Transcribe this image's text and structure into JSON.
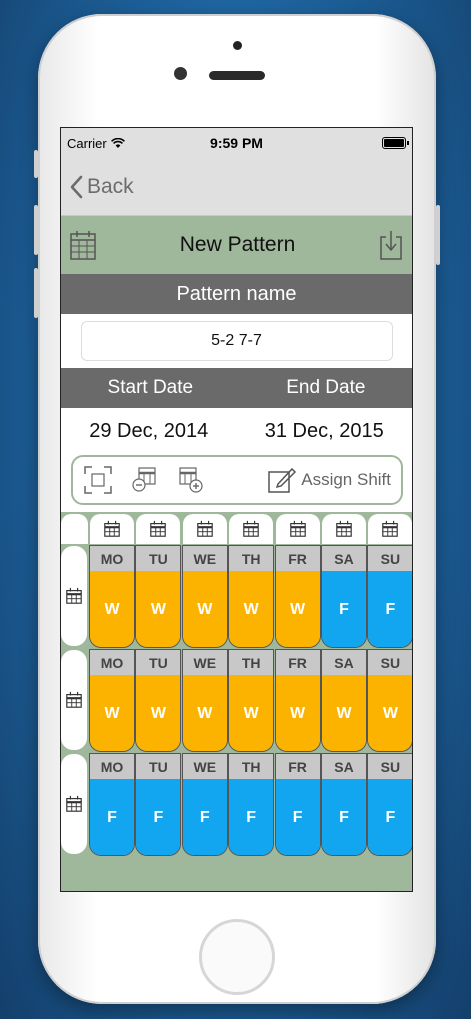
{
  "status": {
    "carrier": "Carrier",
    "time": "9:59 PM"
  },
  "nav": {
    "back_label": "Back"
  },
  "header": {
    "title": "New Pattern"
  },
  "pattern": {
    "section_label": "Pattern name",
    "name_value": "5-2 7-7"
  },
  "dates": {
    "start_label": "Start Date",
    "end_label": "End Date",
    "start_value": "29 Dec, 2014",
    "end_value": "31 Dec, 2015"
  },
  "toolbar": {
    "assign_label": "Assign Shift"
  },
  "colors": {
    "work": "#fbb300",
    "free": "#11a6ef",
    "accent": "#9fb79a",
    "section": "#6a6a6a"
  },
  "weeks": [
    {
      "days": [
        {
          "name": "MO",
          "shift": "W"
        },
        {
          "name": "TU",
          "shift": "W"
        },
        {
          "name": "WE",
          "shift": "W"
        },
        {
          "name": "TH",
          "shift": "W"
        },
        {
          "name": "FR",
          "shift": "W"
        },
        {
          "name": "SA",
          "shift": "F"
        },
        {
          "name": "SU",
          "shift": "F"
        }
      ]
    },
    {
      "days": [
        {
          "name": "MO",
          "shift": "W"
        },
        {
          "name": "TU",
          "shift": "W"
        },
        {
          "name": "WE",
          "shift": "W"
        },
        {
          "name": "TH",
          "shift": "W"
        },
        {
          "name": "FR",
          "shift": "W"
        },
        {
          "name": "SA",
          "shift": "W"
        },
        {
          "name": "SU",
          "shift": "W"
        }
      ]
    },
    {
      "days": [
        {
          "name": "MO",
          "shift": "F"
        },
        {
          "name": "TU",
          "shift": "F"
        },
        {
          "name": "WE",
          "shift": "F"
        },
        {
          "name": "TH",
          "shift": "F"
        },
        {
          "name": "FR",
          "shift": "F"
        },
        {
          "name": "SA",
          "shift": "F"
        },
        {
          "name": "SU",
          "shift": "F"
        }
      ]
    }
  ]
}
